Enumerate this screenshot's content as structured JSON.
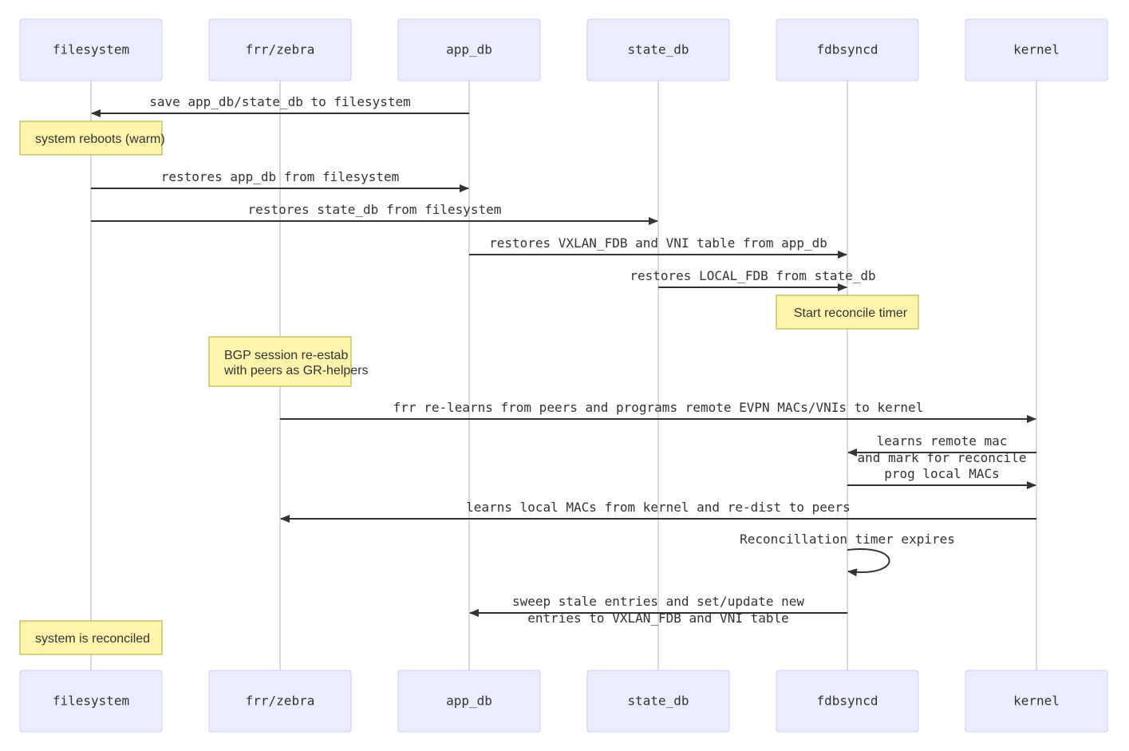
{
  "diagram": {
    "type": "sequence",
    "colors": {
      "actor_fill": "#ECECFF",
      "actor_border": "#CCCCFF",
      "note_fill": "#FFF5AD",
      "note_border": "#AAAA33",
      "line": "#333333",
      "lifeline": "#B5B5B5"
    },
    "actors": [
      {
        "id": "filesystem",
        "label": "filesystem"
      },
      {
        "id": "frr",
        "label": "frr/zebra"
      },
      {
        "id": "app_db",
        "label": "app_db"
      },
      {
        "id": "state_db",
        "label": "state_db"
      },
      {
        "id": "fdbsyncd",
        "label": "fdbsyncd"
      },
      {
        "id": "kernel",
        "label": "kernel"
      }
    ],
    "events": [
      {
        "kind": "message",
        "from": "app_db",
        "to": "filesystem",
        "lines": [
          "save app_db/state_db to filesystem"
        ]
      },
      {
        "kind": "note",
        "over": "filesystem",
        "lines": [
          "system reboots (warm)"
        ]
      },
      {
        "kind": "message",
        "from": "filesystem",
        "to": "app_db",
        "lines": [
          "restores app_db from filesystem"
        ]
      },
      {
        "kind": "message",
        "from": "filesystem",
        "to": "state_db",
        "lines": [
          "restores state_db from filesystem"
        ]
      },
      {
        "kind": "message",
        "from": "app_db",
        "to": "fdbsyncd",
        "lines": [
          "restores VXLAN_FDB and VNI table from app_db"
        ]
      },
      {
        "kind": "message",
        "from": "state_db",
        "to": "fdbsyncd",
        "lines": [
          "restores LOCAL_FDB from state_db"
        ]
      },
      {
        "kind": "note",
        "over": "fdbsyncd",
        "lines": [
          "Start reconcile timer"
        ]
      },
      {
        "kind": "note",
        "over": "frr",
        "lines": [
          "BGP session re-estab",
          "with peers as GR-helpers"
        ]
      },
      {
        "kind": "message",
        "from": "frr",
        "to": "kernel",
        "lines": [
          "frr re-learns from peers and programs remote EVPN MACs/VNIs to kernel"
        ]
      },
      {
        "kind": "message",
        "from": "kernel",
        "to": "fdbsyncd",
        "lines": [
          "learns remote mac",
          "and mark for reconcile"
        ]
      },
      {
        "kind": "message",
        "from": "fdbsyncd",
        "to": "kernel",
        "lines": [
          "prog local MACs"
        ]
      },
      {
        "kind": "message",
        "from": "kernel",
        "to": "frr",
        "lines": [
          "learns local MACs from kernel and re-dist to peers"
        ]
      },
      {
        "kind": "self",
        "actor": "fdbsyncd",
        "lines": [
          "Reconcillation timer expires"
        ]
      },
      {
        "kind": "message",
        "from": "fdbsyncd",
        "to": "app_db",
        "lines": [
          "sweep stale entries and set/update new",
          "entries to VXLAN_FDB and VNI table"
        ]
      },
      {
        "kind": "note",
        "over": "filesystem",
        "lines": [
          "system is reconciled"
        ]
      }
    ]
  }
}
